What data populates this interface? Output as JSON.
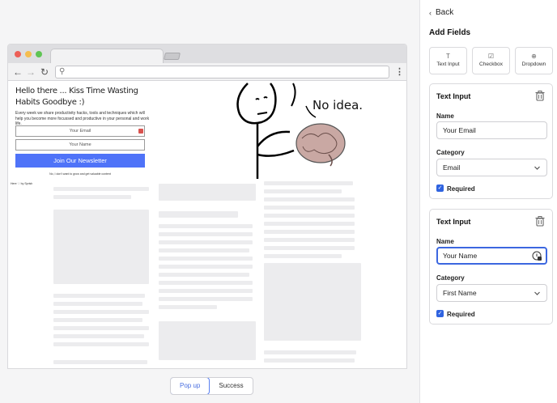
{
  "sidebar": {
    "back_label": "Back",
    "section_title": "Add Fields",
    "field_types": [
      {
        "label": "Text Input",
        "icon": "text-icon"
      },
      {
        "label": "Checkbox",
        "icon": "checkbox-icon"
      },
      {
        "label": "Dropdown",
        "icon": "dropdown-icon"
      }
    ],
    "cards": [
      {
        "title": "Text Input",
        "name_label": "Name",
        "name_value": "Your Email",
        "category_label": "Category",
        "category_value": "Email",
        "required_label": "Required",
        "required": true
      },
      {
        "title": "Text Input",
        "name_label": "Name",
        "name_value": "Your Name",
        "category_label": "Category",
        "category_value": "First Name",
        "required_label": "Required",
        "required": true
      }
    ]
  },
  "preview": {
    "popup": {
      "title": "Hello there ... Kiss Time Wasting Habits Goodbye :)",
      "description": "Every week we share productivity hacks, tools and techniques which will help you become more focussed and productive in your personal and work life.",
      "email_placeholder": "Your Email",
      "name_placeholder": "Your Name",
      "button_label": "Join Our Newsletter",
      "decline_text": "No, I don't want to grow and get valuable content",
      "credit_text": "Here ♡ by Sprish"
    },
    "meme_text": "No idea."
  },
  "segment": {
    "popup_label": "Pop up",
    "success_label": "Success"
  },
  "colors": {
    "accent": "#4f73f8",
    "checkbox": "#2f63e0",
    "focus_border": "#3c67e0"
  }
}
